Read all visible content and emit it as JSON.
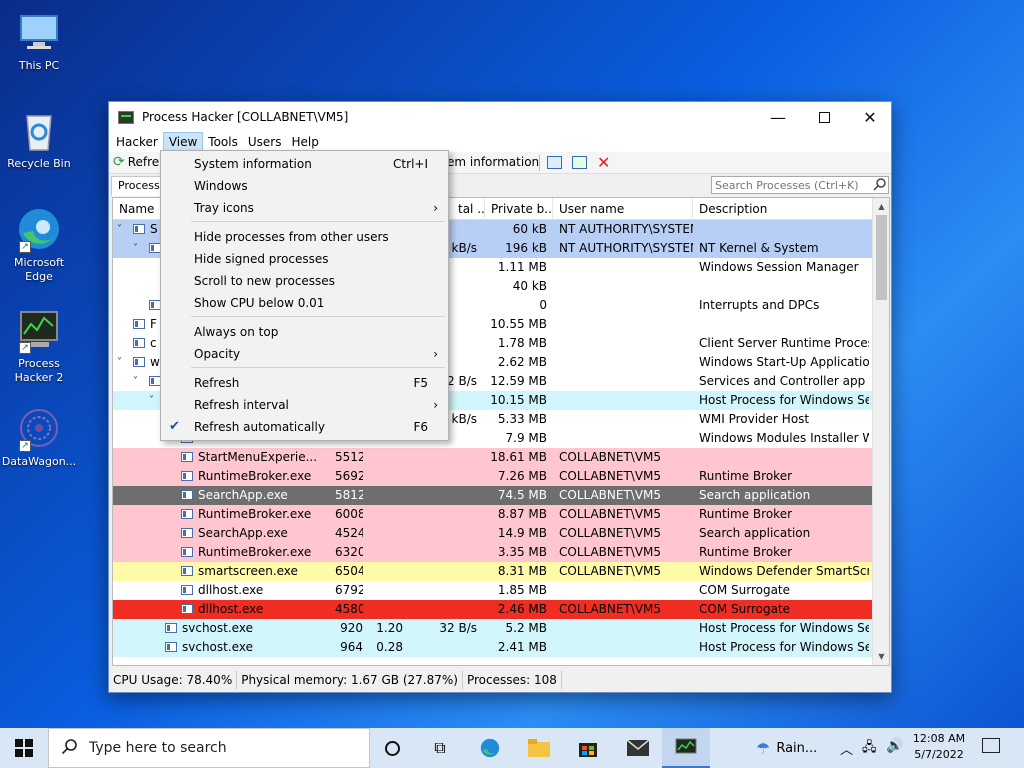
{
  "desktop": {
    "icons": [
      {
        "label": "This PC",
        "icon": "computer-icon"
      },
      {
        "label": "Recycle Bin",
        "icon": "recycle-bin-icon"
      },
      {
        "label": "Microsoft Edge",
        "icon": "edge-icon"
      },
      {
        "label": "Process Hacker 2",
        "icon": "process-hacker-icon"
      },
      {
        "label": "DataWagon...",
        "icon": "datawagon-icon"
      }
    ]
  },
  "window": {
    "title": "Process Hacker [COLLABNET\\VM5]",
    "menu": [
      "Hacker",
      "View",
      "Tools",
      "Users",
      "Help"
    ],
    "toolbar": {
      "refresh_label": "Refre",
      "sysinfo_label": "em information"
    },
    "tab_label": "Processe",
    "search_placeholder": "Search Processes (Ctrl+K)",
    "columns": [
      "Name",
      "tal ...",
      "Private b...",
      "User name",
      "Description"
    ],
    "rows": [
      {
        "name": "S",
        "pid": "",
        "cpu": "",
        "io": "",
        "priv": "60 kB",
        "user": "NT AUTHORITY\\SYSTEM",
        "desc": "",
        "bg": "#b8cff5",
        "indent": 0,
        "tw": "∨"
      },
      {
        "name": "",
        "pid": "",
        "cpu": "",
        "io": "kB/s",
        "priv": "196 kB",
        "user": "NT AUTHORITY\\SYSTEM",
        "desc": "NT Kernel & System",
        "bg": "#b8cff5",
        "indent": 1,
        "tw": "∨"
      },
      {
        "name": "",
        "pid": "",
        "cpu": "",
        "io": "",
        "priv": "1.11 MB",
        "user": "",
        "desc": "Windows Session Manager",
        "bg": "#ffffff",
        "indent": 2,
        "tw": ""
      },
      {
        "name": "",
        "pid": "",
        "cpu": "",
        "io": "",
        "priv": "40 kB",
        "user": "",
        "desc": "",
        "bg": "#ffffff",
        "indent": 2,
        "tw": ""
      },
      {
        "name": "",
        "pid": "",
        "cpu": "",
        "io": "",
        "priv": "0",
        "user": "",
        "desc": "Interrupts and DPCs",
        "bg": "#ffffff",
        "indent": 1,
        "tw": ""
      },
      {
        "name": "F",
        "pid": "",
        "cpu": "",
        "io": "",
        "priv": "10.55 MB",
        "user": "",
        "desc": "",
        "bg": "#ffffff",
        "indent": 0,
        "tw": ""
      },
      {
        "name": "c",
        "pid": "",
        "cpu": "",
        "io": "",
        "priv": "1.78 MB",
        "user": "",
        "desc": "Client Server Runtime Process",
        "bg": "#ffffff",
        "indent": 0,
        "tw": ""
      },
      {
        "name": "w",
        "pid": "",
        "cpu": "",
        "io": "",
        "priv": "2.62 MB",
        "user": "",
        "desc": "Windows Start-Up Application",
        "bg": "#ffffff",
        "indent": 0,
        "tw": "∨"
      },
      {
        "name": "",
        "pid": "",
        "cpu": "",
        "io": "2 B/s",
        "priv": "12.59 MB",
        "user": "",
        "desc": "Services and Controller app",
        "bg": "#ffffff",
        "indent": 1,
        "tw": "∨"
      },
      {
        "name": "",
        "pid": "",
        "cpu": "",
        "io": "",
        "priv": "10.15 MB",
        "user": "",
        "desc": "Host Process for Windows Ser...",
        "bg": "#d0f6fb",
        "indent": 2,
        "tw": "∨"
      },
      {
        "name": "",
        "pid": "",
        "cpu": "",
        "io": "kB/s",
        "priv": "5.33 MB",
        "user": "",
        "desc": "WMI Provider Host",
        "bg": "#ffffff",
        "indent": 3,
        "tw": ""
      },
      {
        "name": "",
        "pid": "",
        "cpu": "",
        "io": "",
        "priv": "7.9 MB",
        "user": "",
        "desc": "Windows Modules Installer W...",
        "bg": "#ffffff",
        "indent": 3,
        "tw": ""
      },
      {
        "name": "StartMenuExperie...",
        "pid": "5512",
        "cpu": "",
        "io": "",
        "priv": "18.61 MB",
        "user": "COLLABNET\\VM5",
        "desc": "",
        "bg": "#ffc6d0",
        "indent": 3,
        "tw": ""
      },
      {
        "name": "RuntimeBroker.exe",
        "pid": "5692",
        "cpu": "",
        "io": "",
        "priv": "7.26 MB",
        "user": "COLLABNET\\VM5",
        "desc": "Runtime Broker",
        "bg": "#ffc6d0",
        "indent": 3,
        "tw": ""
      },
      {
        "name": "SearchApp.exe",
        "pid": "5812",
        "cpu": "",
        "io": "",
        "priv": "74.5 MB",
        "user": "COLLABNET\\VM5",
        "desc": "Search application",
        "bg": "#6e6e6e",
        "indent": 3,
        "tw": ""
      },
      {
        "name": "RuntimeBroker.exe",
        "pid": "6008",
        "cpu": "",
        "io": "",
        "priv": "8.87 MB",
        "user": "COLLABNET\\VM5",
        "desc": "Runtime Broker",
        "bg": "#ffc6d0",
        "indent": 3,
        "tw": ""
      },
      {
        "name": "SearchApp.exe",
        "pid": "4524",
        "cpu": "",
        "io": "",
        "priv": "14.9 MB",
        "user": "COLLABNET\\VM5",
        "desc": "Search application",
        "bg": "#ffc6d0",
        "indent": 3,
        "tw": ""
      },
      {
        "name": "RuntimeBroker.exe",
        "pid": "6320",
        "cpu": "",
        "io": "",
        "priv": "3.35 MB",
        "user": "COLLABNET\\VM5",
        "desc": "Runtime Broker",
        "bg": "#ffc6d0",
        "indent": 3,
        "tw": ""
      },
      {
        "name": "smartscreen.exe",
        "pid": "6504",
        "cpu": "",
        "io": "",
        "priv": "8.31 MB",
        "user": "COLLABNET\\VM5",
        "desc": "Windows Defender SmartScre...",
        "bg": "#fffaa8",
        "indent": 3,
        "tw": ""
      },
      {
        "name": "dllhost.exe",
        "pid": "6792",
        "cpu": "",
        "io": "",
        "priv": "1.85 MB",
        "user": "",
        "desc": "COM Surrogate",
        "bg": "#ffffff",
        "indent": 3,
        "tw": ""
      },
      {
        "name": "dllhost.exe",
        "pid": "4580",
        "cpu": "",
        "io": "",
        "priv": "2.46 MB",
        "user": "COLLABNET\\VM5",
        "desc": "COM Surrogate",
        "bg": "#f02d23",
        "indent": 3,
        "tw": ""
      },
      {
        "name": "svchost.exe",
        "pid": "920",
        "cpu": "1.20",
        "io": "32 B/s",
        "priv": "5.2 MB",
        "user": "",
        "desc": "Host Process for Windows Ser...",
        "bg": "#d0f6fb",
        "indent": 2,
        "tw": ""
      },
      {
        "name": "svchost.exe",
        "pid": "964",
        "cpu": "0.28",
        "io": "",
        "priv": "2.41 MB",
        "user": "",
        "desc": "Host Process for Windows Ser...",
        "bg": "#d0f6fb",
        "indent": 2,
        "tw": ""
      }
    ],
    "status": {
      "cpu": "CPU Usage: 78.40%",
      "memory": "Physical memory: 1.67 GB (27.87%)",
      "processes": "Processes: 108"
    }
  },
  "view_menu": {
    "items": [
      {
        "label": "System information",
        "shortcut": "Ctrl+I",
        "submenu": false,
        "checked": false
      },
      {
        "label": "Windows",
        "shortcut": "",
        "submenu": false,
        "checked": false
      },
      {
        "label": "Tray icons",
        "shortcut": "",
        "submenu": true,
        "checked": false
      },
      {
        "label": "Hide processes from other users",
        "shortcut": "",
        "submenu": false,
        "checked": false
      },
      {
        "label": "Hide signed processes",
        "shortcut": "",
        "submenu": false,
        "checked": false
      },
      {
        "label": "Scroll to new processes",
        "shortcut": "",
        "submenu": false,
        "checked": false
      },
      {
        "label": "Show CPU below 0.01",
        "shortcut": "",
        "submenu": false,
        "checked": false
      },
      {
        "label": "Always on top",
        "shortcut": "",
        "submenu": false,
        "checked": false
      },
      {
        "label": "Opacity",
        "shortcut": "",
        "submenu": true,
        "checked": false
      },
      {
        "label": "Refresh",
        "shortcut": "F5",
        "submenu": false,
        "checked": false
      },
      {
        "label": "Refresh interval",
        "shortcut": "",
        "submenu": true,
        "checked": false
      },
      {
        "label": "Refresh automatically",
        "shortcut": "F6",
        "submenu": false,
        "checked": true
      }
    ]
  },
  "taskbar": {
    "search_placeholder": "Type here to search",
    "weather": "Rain...",
    "time": "12:08 AM",
    "date": "5/7/2022"
  }
}
